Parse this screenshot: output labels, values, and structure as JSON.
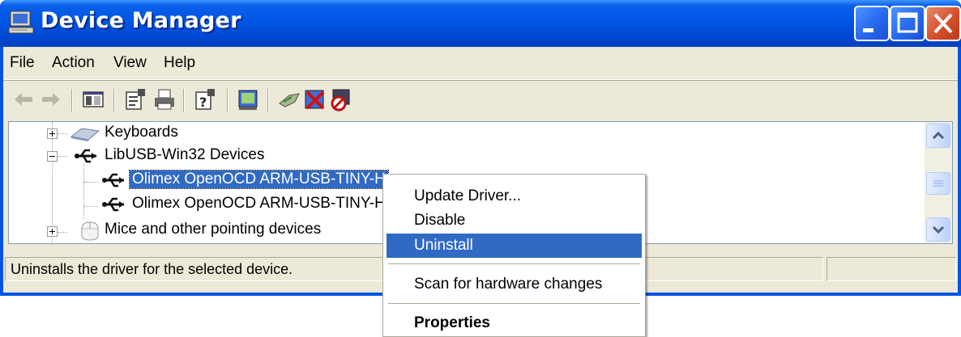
{
  "window": {
    "title": "Device Manager",
    "icon": "computer-icon",
    "controls": [
      "minimize-icon",
      "maximize-icon",
      "close-icon"
    ]
  },
  "menubar": {
    "items": [
      "File",
      "Action",
      "View",
      "Help"
    ]
  },
  "toolbar": {
    "buttons": [
      "back-icon",
      "forward-icon",
      "show-hide-console-tree-icon",
      "properties-icon",
      "print-icon",
      "help-icon",
      "update-driver-icon",
      "scan-hardware-icon",
      "uninstall-icon",
      "disable-icon"
    ]
  },
  "tree": {
    "items": [
      {
        "label": "Keyboards",
        "icon": "keyboard-icon",
        "expander": "plus"
      },
      {
        "label": "LibUSB-Win32 Devices",
        "icon": "usb-icon",
        "expander": "minus"
      },
      {
        "label": "Olimex OpenOCD ARM-USB-TINY-H",
        "icon": "usb-icon",
        "selected": true
      },
      {
        "label": "Olimex OpenOCD ARM-USB-TINY-H",
        "icon": "usb-icon"
      },
      {
        "label": "Mice and other pointing devices",
        "icon": "mouse-icon",
        "expander": "plus"
      }
    ]
  },
  "statusbar": {
    "text": "Uninstalls the driver for the selected device."
  },
  "context_menu": {
    "items": [
      {
        "label": "Update Driver..."
      },
      {
        "label": "Disable"
      },
      {
        "label": "Uninstall",
        "highlighted": true
      },
      {
        "label": "Scan for hardware changes"
      },
      {
        "label": "Properties",
        "bold": true
      }
    ]
  },
  "colors": {
    "titlebar": "#0055e5",
    "selection": "#316ac5",
    "face": "#ece9d8"
  }
}
